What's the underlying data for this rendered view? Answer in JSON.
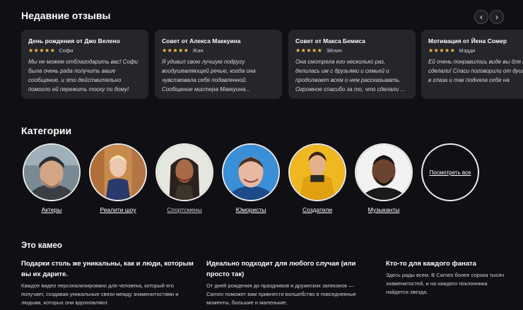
{
  "reviews": {
    "title": "Недавние отзывы",
    "prev_icon": "‹",
    "next_icon": "›",
    "star_color": "#f5c542",
    "items": [
      {
        "title": "День рождения от Джо Велено",
        "stars": "★★★★★",
        "rating": 5,
        "author": "Софи",
        "text": "Мы не можем отблагодарить вас! Софи была очень рада получить ваше сообщение, и это действительно помогло ей пережить тоску по дому!"
      },
      {
        "title": "Совет от Алекса Маккуина",
        "stars": "★★★★★",
        "rating": 5,
        "author": "Жан",
        "text": "Я удивил свою лучшую подругу воодушевляющей речью, когда она чувствовала себя подавленной. Сообщение мистера Маккуина..."
      },
      {
        "title": "Совет от Макса Бемиса",
        "stars": "★★★★★",
        "rating": 5,
        "author": "Эйлин",
        "text": "Она смотрела его несколько раз, делилась им с друзьями и семьей и продолжает всем о нем рассказывать. Огромное спасибо за то, что сделали ..."
      },
      {
        "title": "Мотивация от Йена Сомер",
        "stars": "★★★★★",
        "rating": 5,
        "author": "Мэдди",
        "text": "Ей очень понравилось виде вы для нее сделали! Спаси поговорили от души! Она в глаза и так подняла себе на"
      }
    ]
  },
  "categories": {
    "title": "Категории",
    "items": [
      {
        "label": "Актеры"
      },
      {
        "label": "Реалити шоу"
      },
      {
        "label": "Спортсмены"
      },
      {
        "label": "Юмористы"
      },
      {
        "label": "Создатели"
      },
      {
        "label": "Музыканты"
      }
    ],
    "see_all": "Посмотреть все"
  },
  "about": {
    "title": "Это камео",
    "columns": [
      {
        "heading": "Подарки столь же уникальны, как и люди, которым вы их дарите.",
        "text": "Каждое видео персонализировано для человека, который его получает, создавая уникальные связи между знаменитостями и людьми, которых они вдохновляют."
      },
      {
        "heading": "Идеально подходит для любого случая (или просто так)",
        "text": "От дней рождения до праздников и дружеских запеканок — Cameo поможет вам привнести волшебство в повседневные моменты, большие и маленькие."
      },
      {
        "heading": "Кто-то для каждого фаната",
        "text": "Здесь рады всем. В Cameo более сорока тысяч знаменитостей, и на каждого поклонника найдется звезда."
      }
    ]
  }
}
